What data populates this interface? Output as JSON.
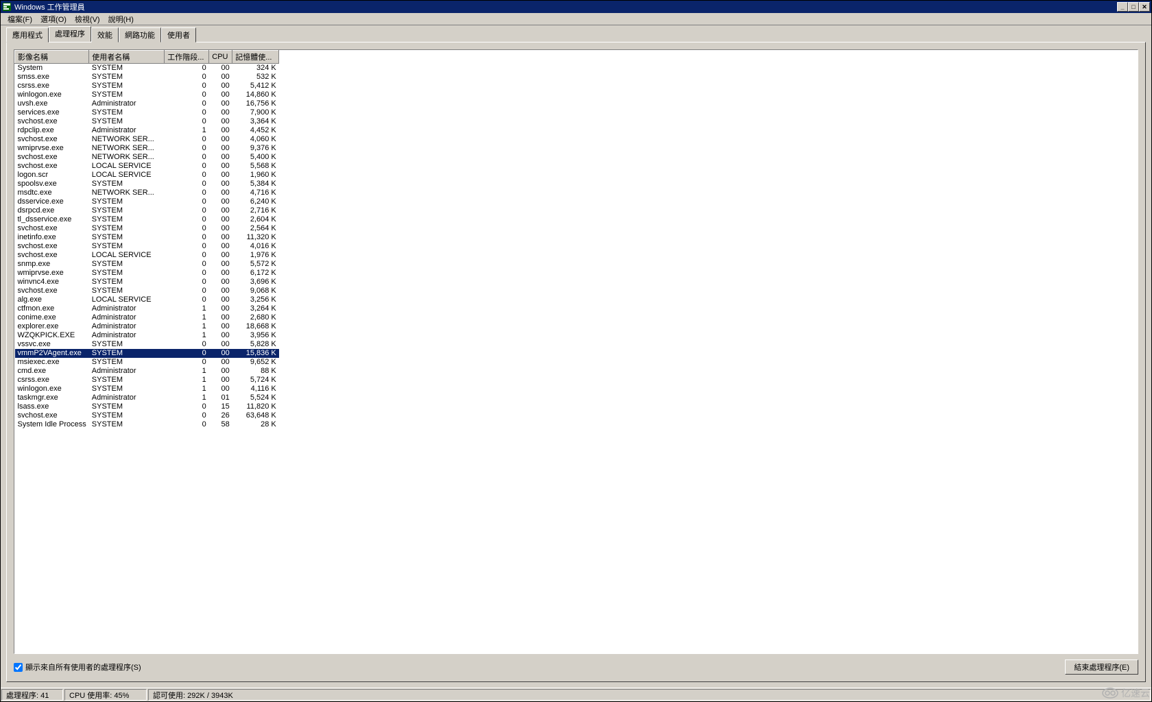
{
  "title": "Windows 工作管理員",
  "menus": {
    "file": "檔案(F)",
    "options": "選項(O)",
    "view": "檢視(V)",
    "help": "說明(H)"
  },
  "tabs": {
    "apps": "應用程式",
    "processes": "處理程序",
    "performance": "效能",
    "networking": "網路功能",
    "users": "使用者"
  },
  "columns": {
    "image": "影像名稱",
    "user": "使用者名稱",
    "session": "工作階段...",
    "cpu": "CPU",
    "memory": "記憶體使..."
  },
  "checkbox_label": "顯示來自所有使用者的處理程序(S)",
  "end_button": "結束處理程序(E)",
  "status": {
    "processes": "處理程序: 41",
    "cpu": "CPU 使用率: 45%",
    "commit": "認可使用: 292K / 3943K"
  },
  "watermark": "亿速云",
  "selected_index": 32,
  "processes": [
    {
      "name": "System",
      "user": "SYSTEM",
      "sid": "0",
      "cpu": "00",
      "mem": "324 K"
    },
    {
      "name": "smss.exe",
      "user": "SYSTEM",
      "sid": "0",
      "cpu": "00",
      "mem": "532 K"
    },
    {
      "name": "csrss.exe",
      "user": "SYSTEM",
      "sid": "0",
      "cpu": "00",
      "mem": "5,412 K"
    },
    {
      "name": "winlogon.exe",
      "user": "SYSTEM",
      "sid": "0",
      "cpu": "00",
      "mem": "14,860 K"
    },
    {
      "name": "uvsh.exe",
      "user": "Administrator",
      "sid": "0",
      "cpu": "00",
      "mem": "16,756 K"
    },
    {
      "name": "services.exe",
      "user": "SYSTEM",
      "sid": "0",
      "cpu": "00",
      "mem": "7,900 K"
    },
    {
      "name": "svchost.exe",
      "user": "SYSTEM",
      "sid": "0",
      "cpu": "00",
      "mem": "3,364 K"
    },
    {
      "name": "rdpclip.exe",
      "user": "Administrator",
      "sid": "1",
      "cpu": "00",
      "mem": "4,452 K"
    },
    {
      "name": "svchost.exe",
      "user": "NETWORK SER...",
      "sid": "0",
      "cpu": "00",
      "mem": "4,060 K"
    },
    {
      "name": "wmiprvse.exe",
      "user": "NETWORK SER...",
      "sid": "0",
      "cpu": "00",
      "mem": "9,376 K"
    },
    {
      "name": "svchost.exe",
      "user": "NETWORK SER...",
      "sid": "0",
      "cpu": "00",
      "mem": "5,400 K"
    },
    {
      "name": "svchost.exe",
      "user": "LOCAL SERVICE",
      "sid": "0",
      "cpu": "00",
      "mem": "5,568 K"
    },
    {
      "name": "logon.scr",
      "user": "LOCAL SERVICE",
      "sid": "0",
      "cpu": "00",
      "mem": "1,960 K"
    },
    {
      "name": "spoolsv.exe",
      "user": "SYSTEM",
      "sid": "0",
      "cpu": "00",
      "mem": "5,384 K"
    },
    {
      "name": "msdtc.exe",
      "user": "NETWORK SER...",
      "sid": "0",
      "cpu": "00",
      "mem": "4,716 K"
    },
    {
      "name": "dsservice.exe",
      "user": "SYSTEM",
      "sid": "0",
      "cpu": "00",
      "mem": "6,240 K"
    },
    {
      "name": "dsrpcd.exe",
      "user": "SYSTEM",
      "sid": "0",
      "cpu": "00",
      "mem": "2,716 K"
    },
    {
      "name": "tl_dsservice.exe",
      "user": "SYSTEM",
      "sid": "0",
      "cpu": "00",
      "mem": "2,604 K"
    },
    {
      "name": "svchost.exe",
      "user": "SYSTEM",
      "sid": "0",
      "cpu": "00",
      "mem": "2,564 K"
    },
    {
      "name": "inetinfo.exe",
      "user": "SYSTEM",
      "sid": "0",
      "cpu": "00",
      "mem": "11,320 K"
    },
    {
      "name": "svchost.exe",
      "user": "SYSTEM",
      "sid": "0",
      "cpu": "00",
      "mem": "4,016 K"
    },
    {
      "name": "svchost.exe",
      "user": "LOCAL SERVICE",
      "sid": "0",
      "cpu": "00",
      "mem": "1,976 K"
    },
    {
      "name": "snmp.exe",
      "user": "SYSTEM",
      "sid": "0",
      "cpu": "00",
      "mem": "5,572 K"
    },
    {
      "name": "wmiprvse.exe",
      "user": "SYSTEM",
      "sid": "0",
      "cpu": "00",
      "mem": "6,172 K"
    },
    {
      "name": "winvnc4.exe",
      "user": "SYSTEM",
      "sid": "0",
      "cpu": "00",
      "mem": "3,696 K"
    },
    {
      "name": "svchost.exe",
      "user": "SYSTEM",
      "sid": "0",
      "cpu": "00",
      "mem": "9,068 K"
    },
    {
      "name": "alg.exe",
      "user": "LOCAL SERVICE",
      "sid": "0",
      "cpu": "00",
      "mem": "3,256 K"
    },
    {
      "name": "ctfmon.exe",
      "user": "Administrator",
      "sid": "1",
      "cpu": "00",
      "mem": "3,264 K"
    },
    {
      "name": "conime.exe",
      "user": "Administrator",
      "sid": "1",
      "cpu": "00",
      "mem": "2,680 K"
    },
    {
      "name": "explorer.exe",
      "user": "Administrator",
      "sid": "1",
      "cpu": "00",
      "mem": "18,668 K"
    },
    {
      "name": "WZQKPICK.EXE",
      "user": "Administrator",
      "sid": "1",
      "cpu": "00",
      "mem": "3,956 K"
    },
    {
      "name": "vssvc.exe",
      "user": "SYSTEM",
      "sid": "0",
      "cpu": "00",
      "mem": "5,828 K"
    },
    {
      "name": "vmmP2VAgent.exe",
      "user": "SYSTEM",
      "sid": "0",
      "cpu": "00",
      "mem": "15,836 K"
    },
    {
      "name": "msiexec.exe",
      "user": "SYSTEM",
      "sid": "0",
      "cpu": "00",
      "mem": "9,652 K"
    },
    {
      "name": "cmd.exe",
      "user": "Administrator",
      "sid": "1",
      "cpu": "00",
      "mem": "88 K"
    },
    {
      "name": "csrss.exe",
      "user": "SYSTEM",
      "sid": "1",
      "cpu": "00",
      "mem": "5,724 K"
    },
    {
      "name": "winlogon.exe",
      "user": "SYSTEM",
      "sid": "1",
      "cpu": "00",
      "mem": "4,116 K"
    },
    {
      "name": "taskmgr.exe",
      "user": "Administrator",
      "sid": "1",
      "cpu": "01",
      "mem": "5,524 K"
    },
    {
      "name": "lsass.exe",
      "user": "SYSTEM",
      "sid": "0",
      "cpu": "15",
      "mem": "11,820 K"
    },
    {
      "name": "svchost.exe",
      "user": "SYSTEM",
      "sid": "0",
      "cpu": "26",
      "mem": "63,648 K"
    },
    {
      "name": "System Idle Process",
      "user": "SYSTEM",
      "sid": "0",
      "cpu": "58",
      "mem": "28 K"
    }
  ]
}
